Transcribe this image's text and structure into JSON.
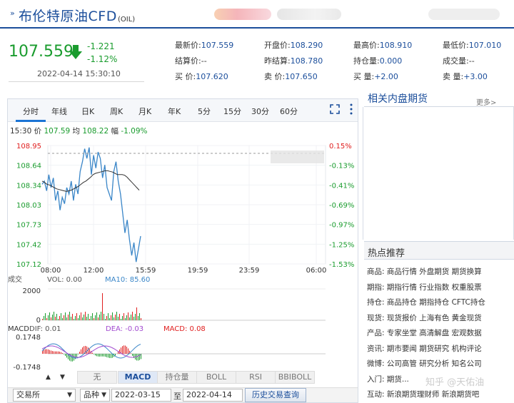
{
  "header": {
    "title": "布伦特原油CFD",
    "code": "(OIL)"
  },
  "quote": {
    "price": "107.559",
    "change": "-1.221",
    "change_pct": "-1.12%",
    "time": "2022-04-14 15:30:10"
  },
  "stats": [
    {
      "label": "最新价:",
      "value": "107.559",
      "color": "blue"
    },
    {
      "label": "开盘价:",
      "value": "108.290",
      "color": "blue"
    },
    {
      "label": "最高价:",
      "value": "108.910",
      "color": "blue"
    },
    {
      "label": "最低价:",
      "value": "107.010",
      "color": "blue"
    },
    {
      "label": "结算价:",
      "value": "--",
      "color": "plain"
    },
    {
      "label": "昨结算:",
      "value": "108.780",
      "color": "blue"
    },
    {
      "label": "持仓量:",
      "value": "0.000",
      "color": "blue"
    },
    {
      "label": "成交量:",
      "value": "--",
      "color": "plain"
    },
    {
      "label": "买   价:",
      "value": "107.620",
      "color": "blue"
    },
    {
      "label": "卖   价:",
      "value": "107.650",
      "color": "blue"
    },
    {
      "label": "买   量:",
      "value": "+2.00",
      "color": "blue"
    },
    {
      "label": "卖   量:",
      "value": "+3.00",
      "color": "blue"
    }
  ],
  "tabs": [
    "分时",
    "年线",
    "日K",
    "周K",
    "月K",
    "年K",
    "5分",
    "15分",
    "30分",
    "60分"
  ],
  "infoline": {
    "time": "15:30",
    "price_label": "价",
    "price": "107.59",
    "avg_label": "均",
    "avg": "108.22",
    "change_label": "幅",
    "change": "-1.09%"
  },
  "chart_labels": {
    "y_left": [
      "108.95",
      "108.64",
      "108.34",
      "108.03",
      "107.73",
      "107.42",
      "107.12"
    ],
    "y_right": [
      "0.15%",
      "-0.13%",
      "-0.41%",
      "-0.69%",
      "-0.97%",
      "-1.25%",
      "-1.53%"
    ],
    "x": [
      "08:00",
      "12:00",
      "15:59",
      "19:59",
      "23:59",
      "06:00"
    ],
    "vol_title": "成交",
    "vol_label": "VOL: 0.00",
    "ma_label": "MA10: 85.60",
    "vol_axis": [
      "2000",
      "0"
    ],
    "macd_title": "MACD",
    "dif": "DIF: 0.01",
    "dea": "DEA: -0.03",
    "macd": "MACD: 0.08",
    "macd_axis": [
      "0.1748",
      "-0.1748"
    ]
  },
  "chart_data": {
    "type": "line",
    "title": "",
    "x_ticks": [
      "08:00",
      "12:00",
      "15:59",
      "19:59",
      "23:59",
      "06:00"
    ],
    "ylim": [
      107.12,
      108.95
    ],
    "series": [
      {
        "name": "价",
        "values": [
          108.35,
          108.4,
          108.25,
          108.5,
          108.3,
          108.45,
          108.1,
          108.25,
          107.95,
          108.15,
          108.05,
          108.3,
          108.2,
          108.4,
          108.1,
          108.35,
          108.2,
          108.55,
          108.7,
          108.9,
          108.75,
          108.92,
          108.5,
          108.8,
          108.6,
          108.85,
          108.75,
          108.45,
          108.65,
          108.3,
          108.2,
          108.1,
          108.55,
          108.7,
          108.4,
          108.2,
          107.9,
          107.6,
          107.8,
          107.5,
          107.25,
          107.45,
          107.15,
          107.35,
          107.55
        ]
      },
      {
        "name": "均",
        "values": [
          108.4,
          108.38,
          108.35,
          108.34,
          108.32,
          108.3,
          108.28,
          108.27,
          108.26,
          108.25,
          108.24,
          108.25,
          108.26,
          108.28,
          108.3,
          108.32,
          108.35,
          108.38,
          108.4,
          108.43,
          108.46,
          108.5,
          108.52,
          108.53,
          108.54,
          108.55,
          108.56,
          108.56,
          108.55,
          108.54,
          108.52,
          108.5,
          108.5,
          108.5,
          108.49,
          108.46,
          108.42,
          108.38,
          108.34,
          108.3,
          108.26
        ]
      }
    ]
  },
  "indicator_buttons": [
    "无",
    "MACD",
    "持仓量",
    "BOLL",
    "RSI",
    "BBIBOLL"
  ],
  "bottom": {
    "exchange": "交易所",
    "variety": "品种",
    "date_from": "2022-03-15",
    "to": "至",
    "date_to": "2022-04-14",
    "query": "历史交易查询"
  },
  "right_panel": {
    "related_title": "相关内盘期货",
    "more": "更多>",
    "hot_title": "热点推荐",
    "rows": [
      {
        "key": "商品:",
        "items": [
          "商品行情",
          "外盘期货",
          "期货换算"
        ]
      },
      {
        "key": "期指:",
        "items": [
          "期指行情",
          "行业指数",
          "权重股票"
        ]
      },
      {
        "key": "持仓:",
        "items": [
          "商品持仓",
          "期指持仓",
          "CFTC持仓"
        ]
      },
      {
        "key": "现货:",
        "items": [
          "现货报价",
          "上海有色",
          "黄金现货"
        ]
      },
      {
        "key": "产品:",
        "items": [
          "专家坐堂",
          "高清解盘",
          "宏观数据"
        ]
      },
      {
        "key": "资讯:",
        "items": [
          "期市要闻",
          "期货研究",
          "机构评论"
        ]
      },
      {
        "key": "微博:",
        "items": [
          "公司高管",
          "研究分析",
          "知名公司"
        ]
      },
      {
        "key": "入门:",
        "items": [
          "期货..."
        ]
      },
      {
        "key": "互动:",
        "items": [
          "新浪期货理财师",
          "新浪期货吧"
        ]
      }
    ],
    "watermark": "知乎 @天佑油"
  },
  "colors": {
    "brand": "#1b4e9b",
    "down": "#1a9c2e",
    "up": "#e02020",
    "price_line": "#3a86c8",
    "avg_line": "#333333"
  }
}
